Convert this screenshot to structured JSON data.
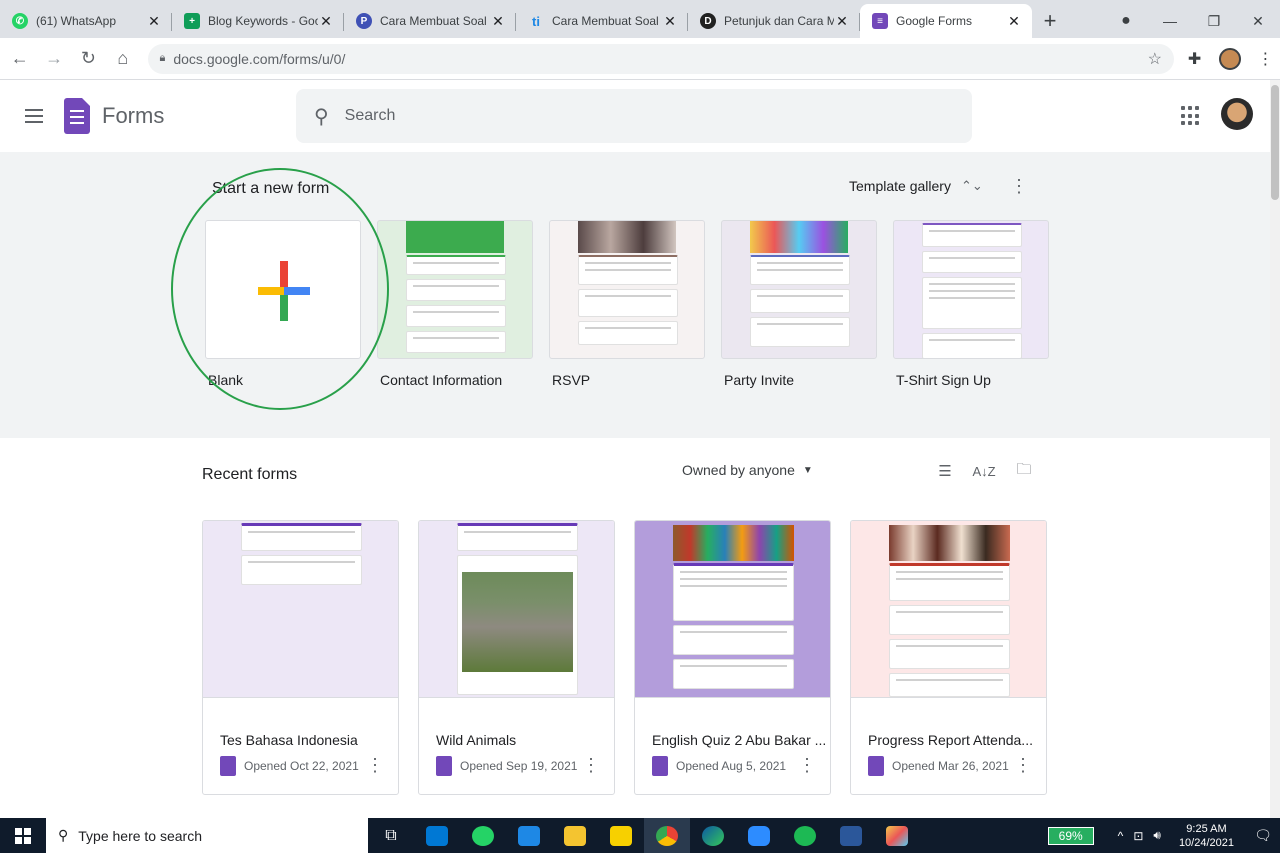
{
  "browser": {
    "tabs": [
      {
        "title": "(61) WhatsApp",
        "favicon": "whatsapp-icon",
        "color": "#25d366"
      },
      {
        "title": "Blog Keywords - Goog",
        "favicon": "sheets-icon",
        "color": "#0f9d58"
      },
      {
        "title": "Cara Membuat Soal di",
        "favicon": "p-icon",
        "color": "#3f51b5"
      },
      {
        "title": "Cara Membuat Soal O",
        "favicon": "ti-icon",
        "color": "#1e88e5"
      },
      {
        "title": "Petunjuk dan Cara Me",
        "favicon": "d-icon",
        "color": "#212121"
      },
      {
        "title": "Google Forms",
        "favicon": "forms-icon",
        "color": "#7248b9"
      }
    ],
    "url": "docs.google.com/forms/u/0/"
  },
  "app": {
    "name": "Forms",
    "search_placeholder": "Search"
  },
  "start": {
    "title": "Start a new form",
    "template_gallery_label": "Template gallery",
    "templates": [
      {
        "label": "Blank"
      },
      {
        "label": "Contact Information"
      },
      {
        "label": "RSVP"
      },
      {
        "label": "Party Invite"
      },
      {
        "label": "T-Shirt Sign Up"
      }
    ]
  },
  "recent": {
    "title": "Recent forms",
    "owner_filter": "Owned by anyone",
    "forms": [
      {
        "name": "Tes Bahasa Indonesia",
        "opened": "Opened Oct 22, 2021"
      },
      {
        "name": "Wild Animals",
        "opened": "Opened Sep 19, 2021"
      },
      {
        "name": "English Quiz 2 Abu Bakar ...",
        "opened": "Opened Aug 5, 2021"
      },
      {
        "name": "Progress Report Attenda...",
        "opened": "Opened Mar 26, 2021"
      }
    ]
  },
  "taskbar": {
    "search_placeholder": "Type here to search",
    "battery": "69%",
    "time": "9:25 AM",
    "date": "10/24/2021"
  },
  "colors": {
    "accent": "#7248b9",
    "highlight_circle": "#29a04a"
  }
}
